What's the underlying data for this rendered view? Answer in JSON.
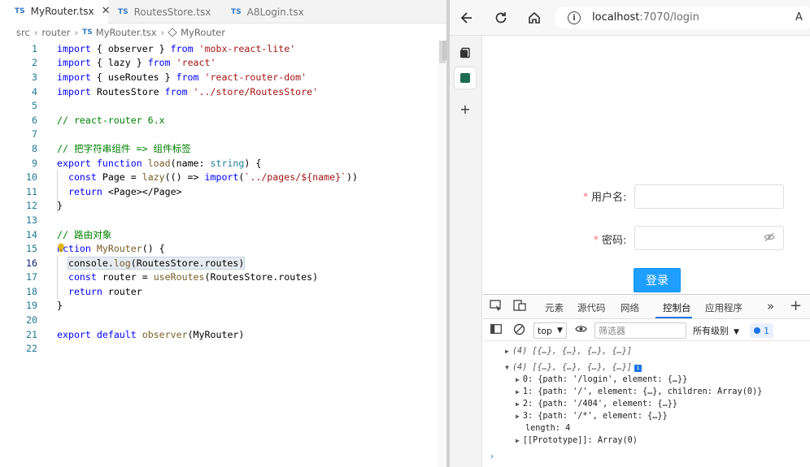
{
  "editor": {
    "tabs": [
      {
        "badge": "TS",
        "name": "MyRouter.tsx",
        "close": "✕"
      },
      {
        "badge": "TS",
        "name": "RoutesStore.tsx"
      },
      {
        "badge": "TS",
        "name": "A8Login.tsx"
      }
    ],
    "breadcrumb": {
      "parts": [
        "src",
        "router",
        "MyRouter.tsx",
        "MyRouter"
      ],
      "ts_badge": "TS"
    },
    "code_lines": [
      "import { observer } from 'mobx-react-lite'",
      "import { lazy } from 'react'",
      "import { useRoutes } from 'react-router-dom'",
      "import RoutesStore from '../store/RoutesStore'",
      "",
      "// react-router 6.x",
      "",
      "// 把字符串组件 => 组件标签",
      "export function load(name: string) {",
      "  const Page = lazy(() => import(`../pages/${name}`))",
      "  return <Page></Page>",
      "}",
      "",
      "// 路由对象",
      "nction MyRouter() {",
      "  console.log(RoutesStore.routes)",
      "  const router = useRoutes(RoutesStore.routes)",
      "  return router",
      "}",
      "",
      "export default observer(MyRouter)",
      ""
    ]
  },
  "browser": {
    "url_host": "localhost",
    "url_rest": ":7070/login",
    "reader_glyph": "A",
    "form": {
      "username_label": "用户名:",
      "password_label": "密码:",
      "required_mark": "*",
      "login_label": "登录"
    },
    "devtools": {
      "tabs": [
        "元素",
        "源代码",
        "网络",
        "控制台",
        "应用程序"
      ],
      "active_tab": "控制台",
      "context": "top",
      "filter_placeholder": "筛选器",
      "levels": "所有级别",
      "issues_count": "1",
      "console_lines": [
        "(4) [{…}, {…}, {…}, {…}]",
        "(4) [{…}, {…}, {…}, {…}]",
        "0: {path: '/login', element: {…}}",
        "1: {path: '/', element: {…}, children: Array(0)}",
        "2: {path: '/404', element: {…}}",
        "3: {path: '/*', element: {…}}",
        "length: 4",
        "[[Prototype]]: Array(0)"
      ],
      "prompt": "›"
    }
  },
  "colors": {
    "login_button": "#1e9fff",
    "required": "#f56c6c",
    "keyword": "#0000ff",
    "string": "#a31515",
    "comment": "#008000"
  }
}
